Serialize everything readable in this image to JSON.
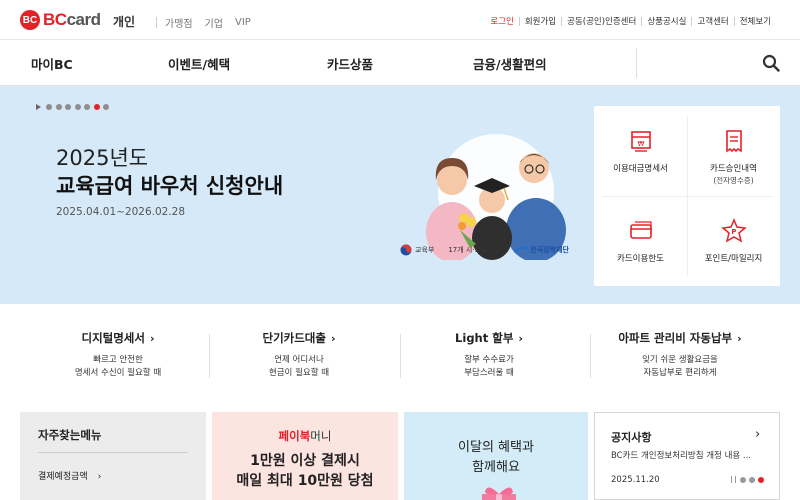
{
  "brand": {
    "logo_mark": "BC",
    "logo_text_red": "BC",
    "logo_text": "card",
    "section": "개인"
  },
  "top_nav_left": [
    "가맹점",
    "기업",
    "VIP"
  ],
  "top_nav_right": [
    "로그인",
    "회원가입",
    "공동(공인)인증센터",
    "상품공시실",
    "고객센터",
    "전체보기"
  ],
  "main_nav": [
    "마이BC",
    "이벤트/혜택",
    "카드상품",
    "금융/생활편의"
  ],
  "hero": {
    "year": "2025년도",
    "title": "교육급여 바우처 신청안내",
    "date": "2025.04.01~2026.02.28",
    "sponsors": [
      "교육부",
      "17개 시·도교육청",
      "한국장학재단"
    ],
    "slides_total": 7,
    "slide_active": 6
  },
  "quick_menu": [
    {
      "label": "이용대금명세서",
      "sub": "",
      "icon": "statement-icon"
    },
    {
      "label": "카드승인내역",
      "sub": "(전자영수증)",
      "icon": "receipt-icon"
    },
    {
      "label": "카드이용한도",
      "sub": "",
      "icon": "card-limit-icon"
    },
    {
      "label": "포인트/마일리지",
      "sub": "",
      "icon": "point-icon"
    }
  ],
  "services": [
    {
      "title": "디지털명세서",
      "desc1": "빠르고 안전한",
      "desc2": "명세서 수신이 필요할 때"
    },
    {
      "title": "단기카드대출",
      "desc1": "언제 어디서나",
      "desc2": "현금이 필요할 때"
    },
    {
      "title": "Light 할부",
      "desc1": "할부 수수료가",
      "desc2": "부담스러울 때"
    },
    {
      "title": "아파트 관리비 자동납부",
      "desc1": "잊기 쉬운 생활요금을",
      "desc2": "자동납부로 편리하게"
    }
  ],
  "faq": {
    "title": "자주찾는메뉴",
    "item": "결제예정금액"
  },
  "paybook": {
    "brand": "페이북",
    "brand_suffix": "머니",
    "line1": "1만원 이상 결제시",
    "line2": "매일 최대 10만원 당첨"
  },
  "benefit": {
    "line1": "이달의 혜택과",
    "line2": "함께해요"
  },
  "notice": {
    "title": "공지사항",
    "text": "BC카드 개인정보처리방침 개정 내용 ...",
    "date": "2025.11.20",
    "dots_total": 3,
    "dot_active": 3
  },
  "colors": {
    "accent": "#e32227",
    "hero_bg": "#d6e9f8",
    "paybook_bg": "#fce4e1",
    "benefit_bg": "#d3ecf8"
  }
}
